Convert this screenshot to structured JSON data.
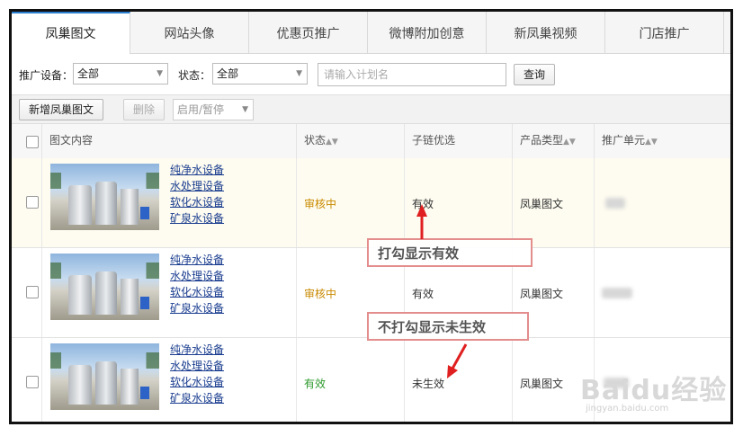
{
  "tabs": [
    "凤巢图文",
    "网站头像",
    "优惠页推广",
    "微博附加创意",
    "新凤巢视频",
    "门店推广"
  ],
  "filters": {
    "device_label": "推广设备：",
    "device_value": "全部",
    "status_label": "状态：",
    "status_value": "全部",
    "search_placeholder": "请输入计划名",
    "query_button": "查询"
  },
  "actions": {
    "add_button": "新增凤巢图文",
    "delete_button": "删除",
    "toggle_select": "启用/暂停"
  },
  "table": {
    "headers": [
      "图文内容",
      "状态",
      "子链优选",
      "产品类型",
      "推广单元"
    ],
    "rows": [
      {
        "links": [
          "纯净水设备",
          "水处理设备",
          "软化水设备",
          "矿泉水设备"
        ],
        "status": "审核中",
        "sublink": "有效",
        "product_type": "凤巢图文"
      },
      {
        "links": [
          "纯净水设备",
          "水处理设备",
          "软化水设备",
          "矿泉水设备"
        ],
        "status": "审核中",
        "sublink": "有效",
        "product_type": "凤巢图文"
      },
      {
        "links": [
          "纯净水设备",
          "水处理设备",
          "软化水设备",
          "矿泉水设备"
        ],
        "status": "有效",
        "sublink": "未生效",
        "product_type": "凤巢图文"
      }
    ]
  },
  "annotations": {
    "callout_1": "打勾显示有效",
    "callout_2": "不打勾显示未生效"
  },
  "watermark": {
    "brand": "Baidu经验",
    "url": "jingyan.baidu.com"
  },
  "colors": {
    "status_pending": "#c98a00",
    "status_valid": "#2e9a2e",
    "arrow_red": "#e02020"
  }
}
